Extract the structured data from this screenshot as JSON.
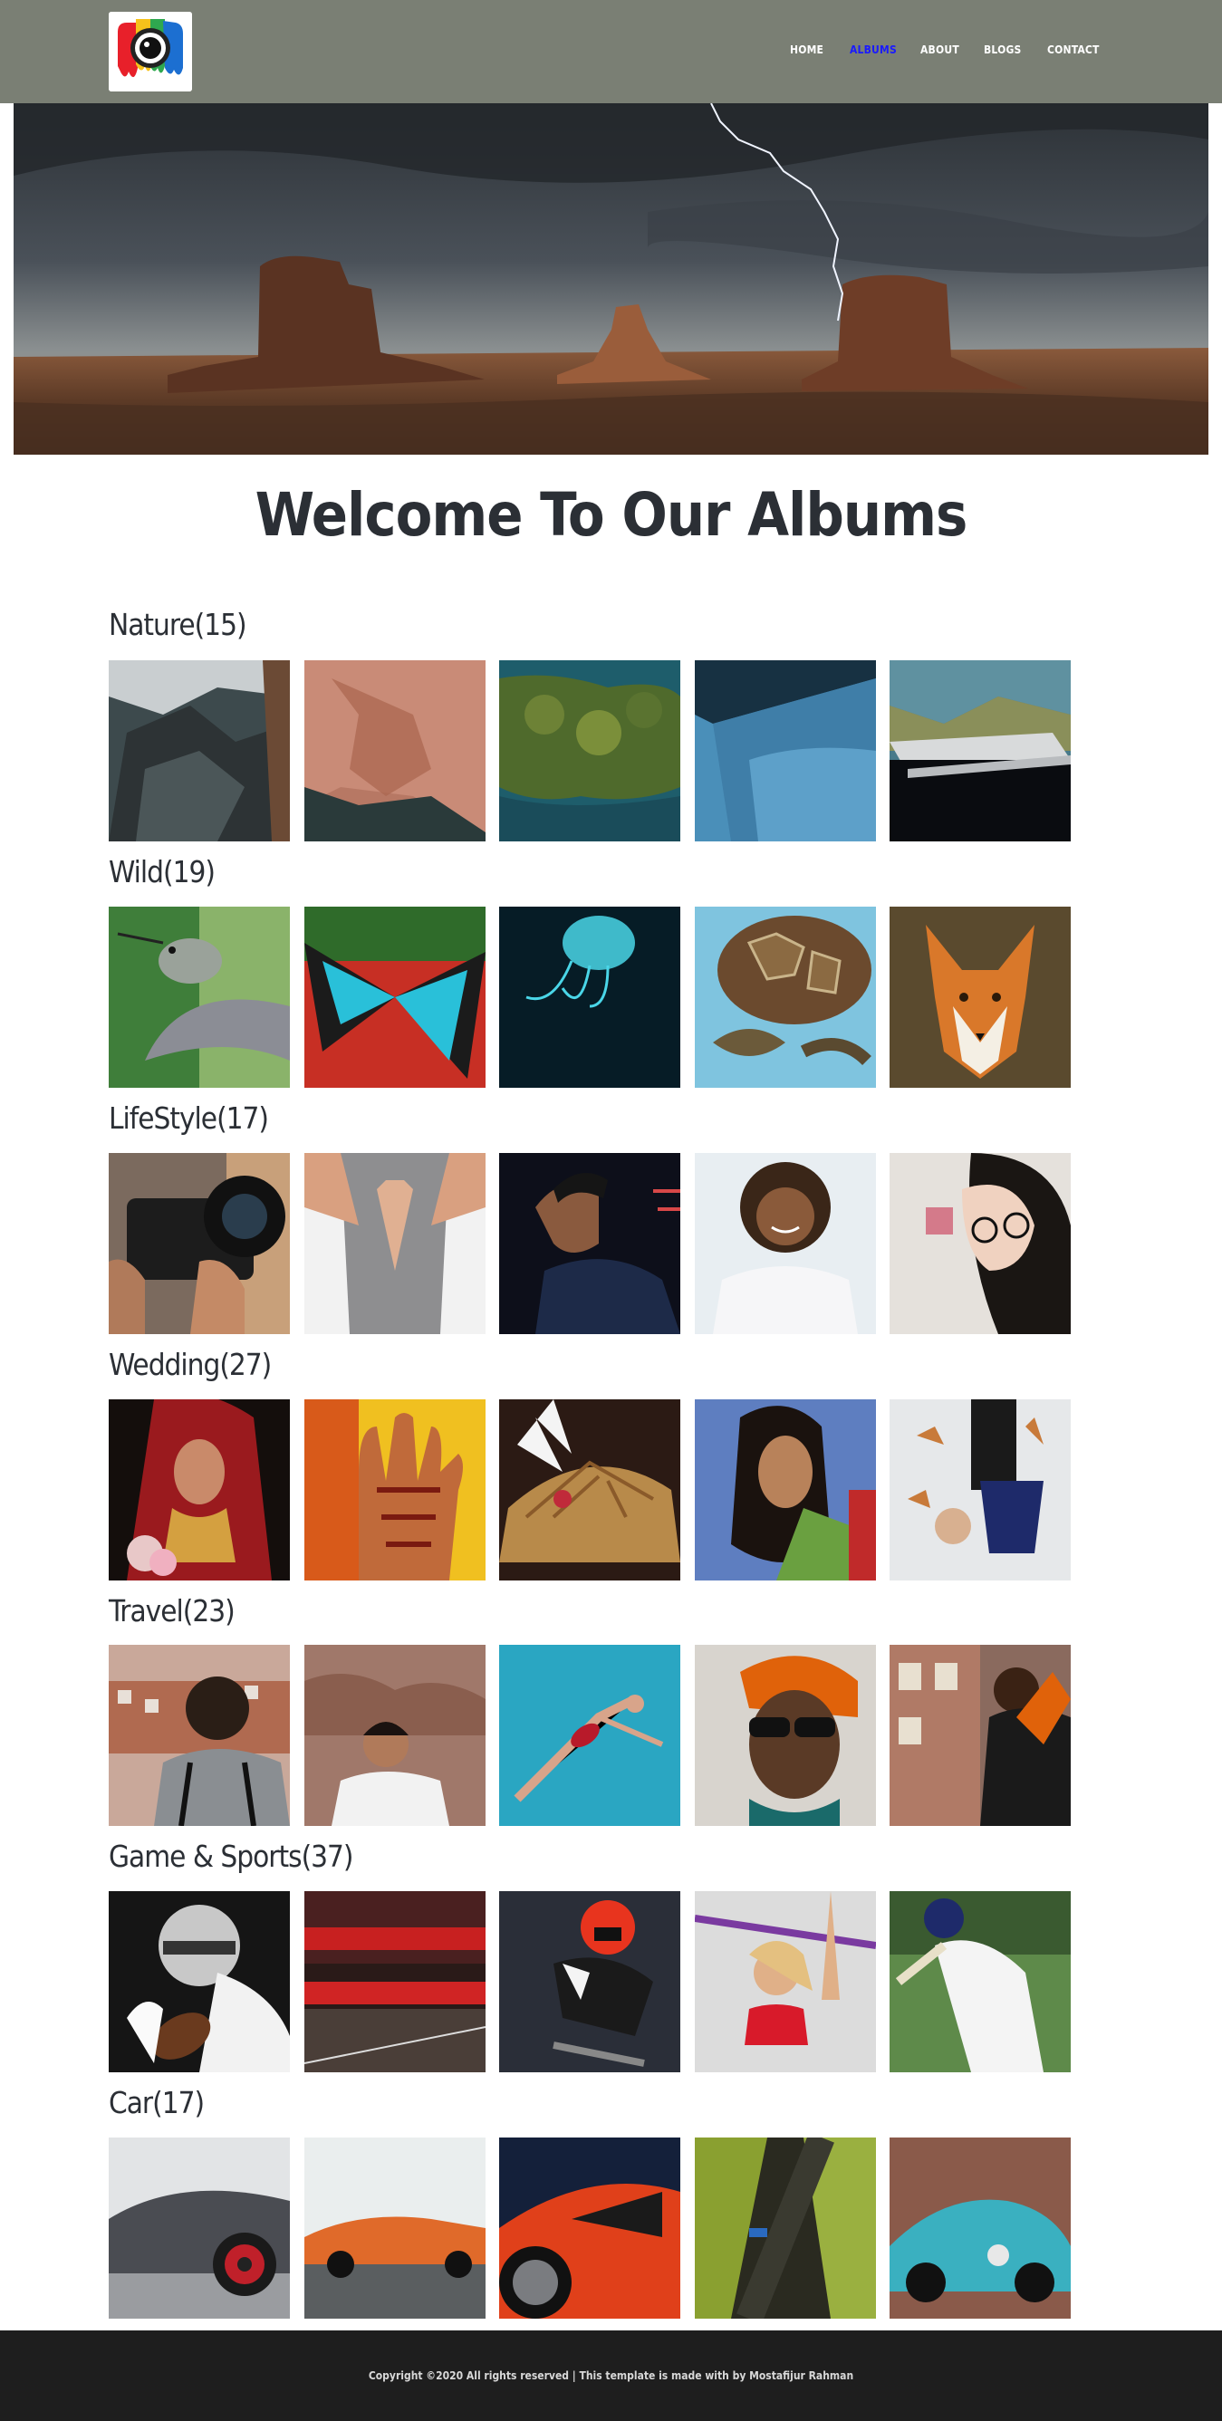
{
  "nav": {
    "logo": "camera-logo",
    "links": [
      {
        "label": "HOME",
        "active": false
      },
      {
        "label": "ALBUMS",
        "active": true
      },
      {
        "label": "ABOUT",
        "active": false
      },
      {
        "label": "BLOGS",
        "active": false
      },
      {
        "label": "CONTACT",
        "active": false
      }
    ]
  },
  "hero": {
    "image": "desert-buttes-lightning-storm"
  },
  "main": {
    "title": "Welcome To Our Albums"
  },
  "albums": [
    {
      "title": "Nature(15)",
      "photos": [
        "rocky-cliff",
        "red-rock-canyon",
        "aerial-coast-trees",
        "blue-water-boat",
        "mountain-hut"
      ]
    },
    {
      "title": "Wild(19)",
      "photos": [
        "hummingbird",
        "blue-butterfly",
        "jellyfish",
        "sea-turtle",
        "red-fox"
      ]
    },
    {
      "title": "LifeStyle(17)",
      "photos": [
        "photographer-camera",
        "yoga-prayer-hands",
        "man-with-earphones",
        "smiling-girl",
        "woman-with-glasses"
      ]
    },
    {
      "title": "Wedding(27)",
      "photos": [
        "bride-red-saree",
        "henna-hand",
        "groom-turban",
        "woman-portrait",
        "couple-in-leaves"
      ]
    },
    {
      "title": "Travel(23)",
      "photos": [
        "woman-city-view",
        "man-in-ruins",
        "swimmer-in-pool",
        "woman-sunglasses-orange-scarf",
        "man-with-phone"
      ]
    },
    {
      "title": "Game & Sports(37)",
      "photos": [
        "football-player",
        "stadium-match",
        "motocross-rider",
        "cheerleader",
        "cricket-batsman"
      ]
    },
    {
      "title": "Car(17)",
      "photos": [
        "silver-supercar",
        "orange-lamborghini",
        "red-supercar-closeup",
        "aerial-road-car",
        "vintage-blue-car"
      ]
    }
  ],
  "footer": {
    "text": "Copyright ©2020 All rights reserved | This template is made with by Mostafijur Rahman"
  }
}
